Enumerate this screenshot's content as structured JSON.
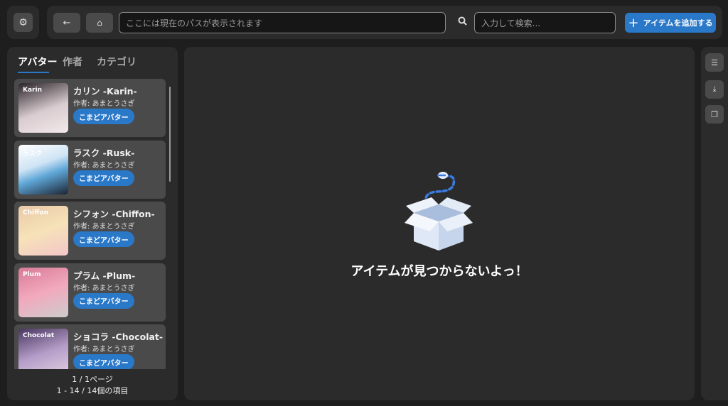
{
  "toolbar": {
    "path_placeholder": "ここには現在のパスが表示されます",
    "search_placeholder": "入力して検索...",
    "add_label": "アイテムを追加する"
  },
  "tabs": [
    {
      "label": "アバター",
      "active": true
    },
    {
      "label": "作者"
    },
    {
      "label": "カテゴリ"
    }
  ],
  "items": [
    {
      "name": "カリン -Karin-",
      "author": "作者: あまとうさぎ",
      "category": "こまどアバター",
      "thumb_text": "Karin"
    },
    {
      "name": "ラスク -Rusk-",
      "author": "作者: あまとうさぎ",
      "category": "こまどアバター",
      "thumb_text": "ラスク"
    },
    {
      "name": "シフォン -Chiffon-",
      "author": "作者: あまとうさぎ",
      "category": "こまどアバター",
      "thumb_text": "Chiffon"
    },
    {
      "name": "プラム -Plum-",
      "author": "作者: あまとうさぎ",
      "category": "こまどアバター",
      "thumb_text": "Plum"
    },
    {
      "name": "ショコラ -Chocolat-",
      "author": "作者: あまとうさぎ",
      "category": "こまどアバター",
      "thumb_text": "Chocolat"
    }
  ],
  "pagination": {
    "page": "1 / 1ページ",
    "range": "1 - 14 / 14個の項目"
  },
  "empty": {
    "message": "アイテムが見つからないよっ！"
  },
  "colors": {
    "accent": "#2a78c8",
    "background": "#1e1e1e",
    "panel": "#2b2b2b"
  }
}
